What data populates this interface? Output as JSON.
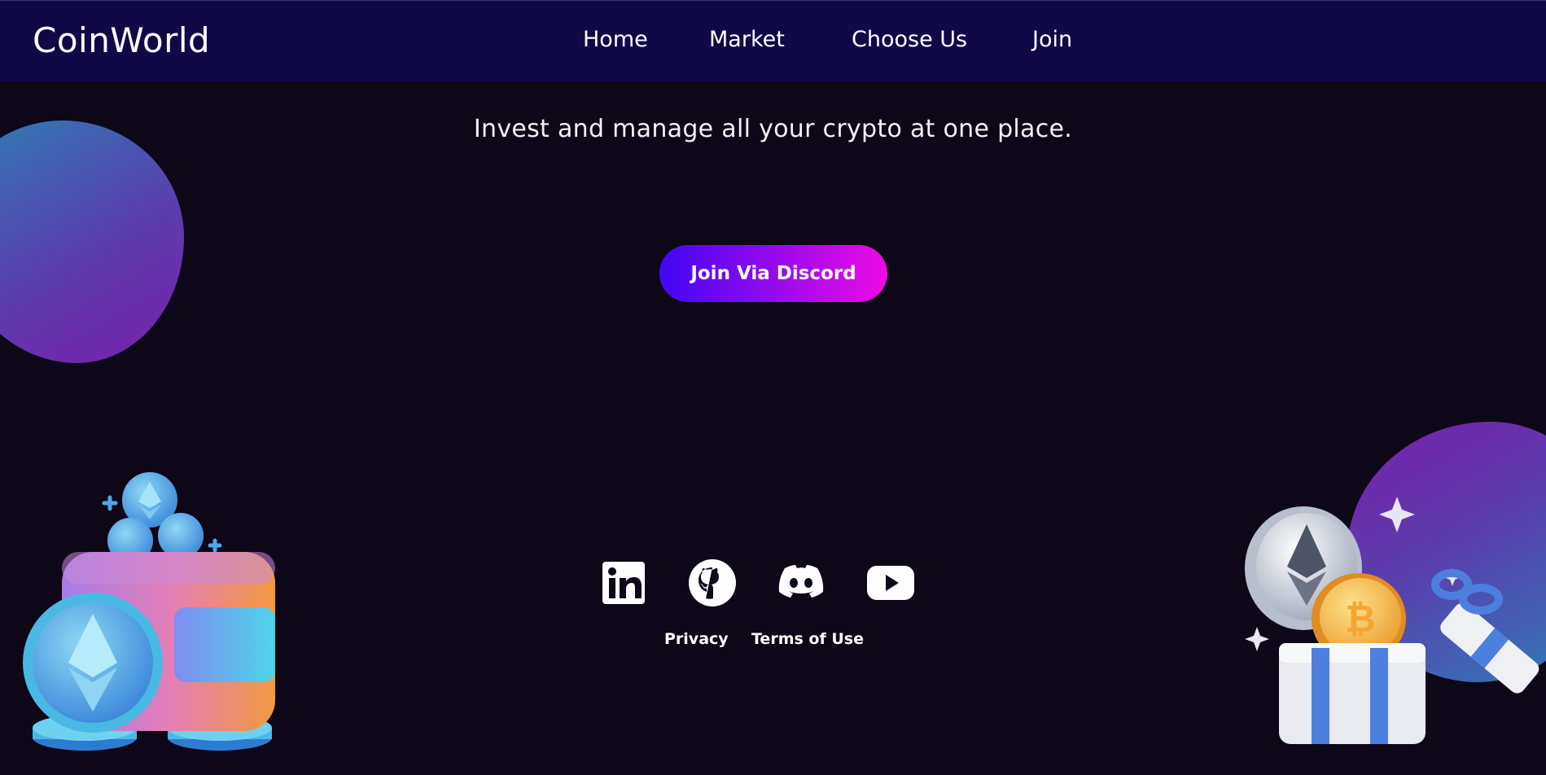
{
  "header": {
    "brand": "CoinWorld",
    "nav": [
      "Home",
      "Market",
      "Choose Us",
      "Join"
    ]
  },
  "hero": {
    "tagline": "Invest and manage all your crypto at one place.",
    "cta_label": "Join Via Discord"
  },
  "footer": {
    "social_icons": [
      "linkedin-icon",
      "github-icon",
      "discord-icon",
      "youtube-icon"
    ],
    "links": [
      "Privacy",
      "Terms of Use"
    ]
  },
  "colors": {
    "page_background": "#0e0718",
    "navbar_background": "#110848",
    "cta_gradient_start": "#3f09f5",
    "cta_gradient_end": "#ee0ae6",
    "text": "#ffffff"
  }
}
